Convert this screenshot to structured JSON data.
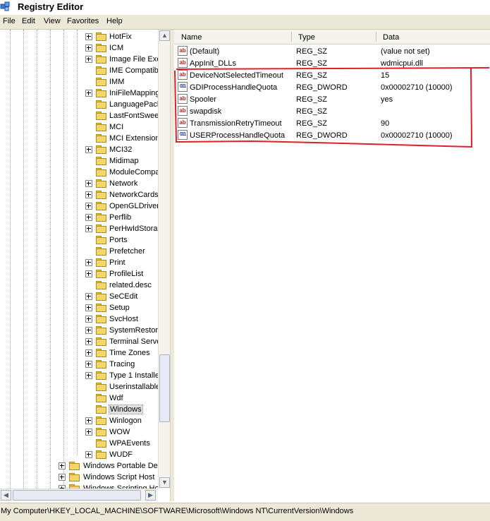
{
  "window": {
    "title": "Registry Editor"
  },
  "menu": [
    "File",
    "Edit",
    "View",
    "Favorites",
    "Help"
  ],
  "tree": {
    "items": [
      {
        "label": "HotFix",
        "expandable": true
      },
      {
        "label": "ICM",
        "expandable": true
      },
      {
        "label": "Image File Exe",
        "expandable": true
      },
      {
        "label": "IME Compatib",
        "expandable": false
      },
      {
        "label": "IMM",
        "expandable": false
      },
      {
        "label": "IniFileMapping",
        "expandable": true
      },
      {
        "label": "LanguagePack",
        "expandable": false
      },
      {
        "label": "LastFontSwee",
        "expandable": false
      },
      {
        "label": "MCI",
        "expandable": false
      },
      {
        "label": "MCI Extension",
        "expandable": false
      },
      {
        "label": "MCI32",
        "expandable": true
      },
      {
        "label": "Midimap",
        "expandable": false
      },
      {
        "label": "ModuleCompa",
        "expandable": false
      },
      {
        "label": "Network",
        "expandable": true
      },
      {
        "label": "NetworkCards",
        "expandable": true
      },
      {
        "label": "OpenGLDriver",
        "expandable": true
      },
      {
        "label": "Perflib",
        "expandable": true
      },
      {
        "label": "PerHwIdStora",
        "expandable": true
      },
      {
        "label": "Ports",
        "expandable": false
      },
      {
        "label": "Prefetcher",
        "expandable": false
      },
      {
        "label": "Print",
        "expandable": true
      },
      {
        "label": "ProfileList",
        "expandable": true
      },
      {
        "label": "related.desc",
        "expandable": false
      },
      {
        "label": "SeCEdit",
        "expandable": true
      },
      {
        "label": "Setup",
        "expandable": true
      },
      {
        "label": "SvcHost",
        "expandable": true
      },
      {
        "label": "SystemRestor",
        "expandable": true
      },
      {
        "label": "Terminal Serve",
        "expandable": true
      },
      {
        "label": "Time Zones",
        "expandable": true
      },
      {
        "label": "Tracing",
        "expandable": true
      },
      {
        "label": "Type 1 Installe",
        "expandable": true
      },
      {
        "label": "Userinstallable",
        "expandable": false
      },
      {
        "label": "Wdf",
        "expandable": false
      },
      {
        "label": "Windows",
        "expandable": false,
        "selected": true
      },
      {
        "label": "Winlogon",
        "expandable": true
      },
      {
        "label": "WOW",
        "expandable": true
      },
      {
        "label": "WPAEvents",
        "expandable": false
      },
      {
        "label": "WUDF",
        "expandable": true
      }
    ],
    "parent_items": [
      {
        "label": "Windows Portable Dev"
      },
      {
        "label": "Windows Script Host"
      },
      {
        "label": "Windows Scripting Ho"
      }
    ]
  },
  "list": {
    "columns": [
      "Name",
      "Type",
      "Data"
    ],
    "rows": [
      {
        "name": "(Default)",
        "type": "REG_SZ",
        "data": "(value not set)",
        "icon": "sz"
      },
      {
        "name": "AppInit_DLLs",
        "type": "REG_SZ",
        "data": "wdmicpui.dll",
        "icon": "sz"
      },
      {
        "name": "DeviceNotSelectedTimeout",
        "type": "REG_SZ",
        "data": "15",
        "icon": "sz"
      },
      {
        "name": "GDIProcessHandleQuota",
        "type": "REG_DWORD",
        "data": "0x00002710 (10000)",
        "icon": "dword"
      },
      {
        "name": "Spooler",
        "type": "REG_SZ",
        "data": "yes",
        "icon": "sz"
      },
      {
        "name": "swapdisk",
        "type": "REG_SZ",
        "data": "",
        "icon": "sz"
      },
      {
        "name": "TransmissionRetryTimeout",
        "type": "REG_SZ",
        "data": "90",
        "icon": "sz"
      },
      {
        "name": "USERProcessHandleQuota",
        "type": "REG_DWORD",
        "data": "0x00002710 (10000)",
        "icon": "dword"
      }
    ]
  },
  "statusbar": {
    "path": "My Computer\\HKEY_LOCAL_MACHINE\\SOFTWARE\\Microsoft\\Windows NT\\CurrentVersion\\Windows"
  },
  "annotation": {
    "color": "#e0202a"
  }
}
